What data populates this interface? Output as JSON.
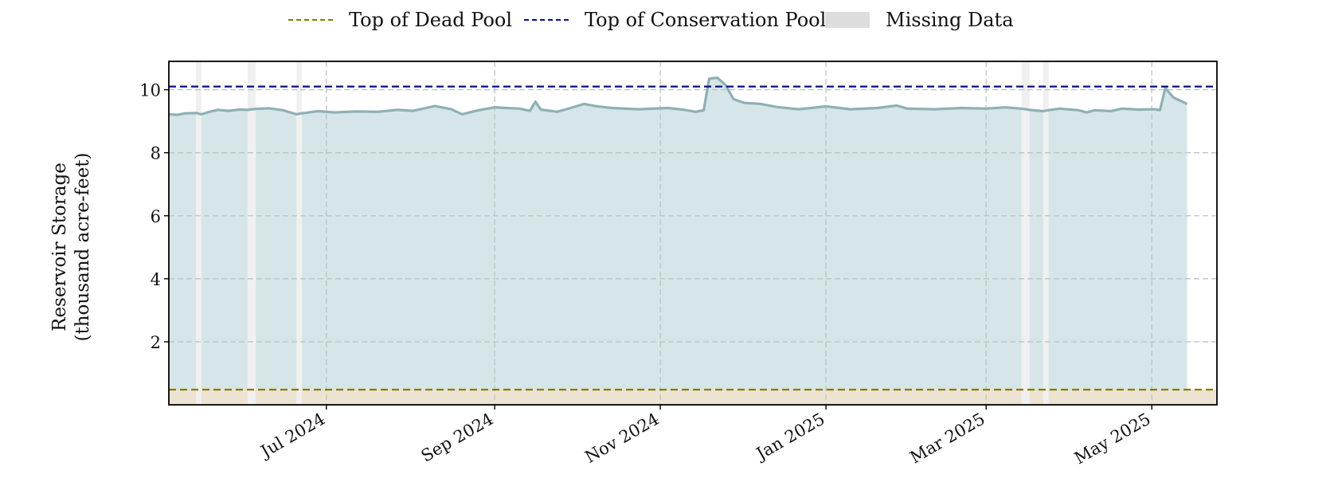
{
  "legend": {
    "dead_pool": "Top of Dead Pool",
    "conservation_pool": "Top of Conservation Pool",
    "missing": "Missing Data"
  },
  "colors": {
    "storage_line": "#8fb0b4",
    "storage_fill": "#d6e6e8",
    "dead_pool_line": "#8a7a00",
    "dead_pool_fill": "#ece3d2",
    "conservation_line": "#0a0a8a",
    "missing_band": "#f0f0f0",
    "legend_missing_swatch": "#dddddd",
    "grid": "#b8c8c0"
  },
  "chart_data": {
    "type": "area",
    "ylabel_line1": "Reservoir Storage",
    "ylabel_line2": "(thousand acre-feet)",
    "xlim": [
      "2024-05-04",
      "2025-05-25"
    ],
    "ylim": [
      0,
      10.9
    ],
    "yticks": [
      2,
      4,
      6,
      8,
      10
    ],
    "xticks": [
      {
        "date": "2024-07-01",
        "label": "Jul 2024"
      },
      {
        "date": "2024-09-01",
        "label": "Sep 2024"
      },
      {
        "date": "2024-11-01",
        "label": "Nov 2024"
      },
      {
        "date": "2025-01-01",
        "label": "Jan 2025"
      },
      {
        "date": "2025-03-01",
        "label": "Mar 2025"
      },
      {
        "date": "2025-05-01",
        "label": "May 2025"
      }
    ],
    "grid": true,
    "legend_position": "top-center",
    "dead_pool_level": 0.48,
    "conservation_pool_level": 10.1,
    "missing_ranges": [
      [
        "2024-05-14",
        "2024-05-16"
      ],
      [
        "2024-06-02",
        "2024-06-05"
      ],
      [
        "2024-06-20",
        "2024-06-22"
      ],
      [
        "2025-03-14",
        "2025-03-17"
      ],
      [
        "2025-03-22",
        "2025-03-24"
      ]
    ],
    "series": [
      {
        "name": "Reservoir Storage",
        "points": [
          [
            "2024-05-04",
            9.22
          ],
          [
            "2024-05-07",
            9.2
          ],
          [
            "2024-05-10",
            9.25
          ],
          [
            "2024-05-14",
            9.26
          ],
          [
            "2024-05-16",
            9.22
          ],
          [
            "2024-05-19",
            9.3
          ],
          [
            "2024-05-22",
            9.36
          ],
          [
            "2024-05-26",
            9.33
          ],
          [
            "2024-05-30",
            9.37
          ],
          [
            "2024-06-02",
            9.36
          ],
          [
            "2024-06-05",
            9.39
          ],
          [
            "2024-06-10",
            9.41
          ],
          [
            "2024-06-15",
            9.35
          ],
          [
            "2024-06-20",
            9.22
          ],
          [
            "2024-06-22",
            9.25
          ],
          [
            "2024-06-28",
            9.32
          ],
          [
            "2024-07-04",
            9.28
          ],
          [
            "2024-07-12",
            9.31
          ],
          [
            "2024-07-20",
            9.3
          ],
          [
            "2024-07-27",
            9.36
          ],
          [
            "2024-08-02",
            9.33
          ],
          [
            "2024-08-10",
            9.48
          ],
          [
            "2024-08-16",
            9.38
          ],
          [
            "2024-08-20",
            9.22
          ],
          [
            "2024-08-26",
            9.35
          ],
          [
            "2024-09-01",
            9.44
          ],
          [
            "2024-09-10",
            9.4
          ],
          [
            "2024-09-14",
            9.33
          ],
          [
            "2024-09-16",
            9.62
          ],
          [
            "2024-09-18",
            9.37
          ],
          [
            "2024-09-24",
            9.3
          ],
          [
            "2024-09-29",
            9.42
          ],
          [
            "2024-10-04",
            9.55
          ],
          [
            "2024-10-08",
            9.48
          ],
          [
            "2024-10-14",
            9.42
          ],
          [
            "2024-10-24",
            9.38
          ],
          [
            "2024-11-04",
            9.42
          ],
          [
            "2024-11-10",
            9.36
          ],
          [
            "2024-11-14",
            9.3
          ],
          [
            "2024-11-17",
            9.35
          ],
          [
            "2024-11-19",
            10.35
          ],
          [
            "2024-11-22",
            10.38
          ],
          [
            "2024-11-25",
            10.15
          ],
          [
            "2024-11-28",
            9.7
          ],
          [
            "2024-12-02",
            9.58
          ],
          [
            "2024-12-08",
            9.55
          ],
          [
            "2024-12-14",
            9.45
          ],
          [
            "2024-12-22",
            9.38
          ],
          [
            "2025-01-01",
            9.47
          ],
          [
            "2025-01-10",
            9.38
          ],
          [
            "2025-01-20",
            9.42
          ],
          [
            "2025-01-27",
            9.5
          ],
          [
            "2025-01-31",
            9.4
          ],
          [
            "2025-02-10",
            9.38
          ],
          [
            "2025-02-20",
            9.42
          ],
          [
            "2025-03-01",
            9.4
          ],
          [
            "2025-03-08",
            9.44
          ],
          [
            "2025-03-14",
            9.4
          ],
          [
            "2025-03-17",
            9.36
          ],
          [
            "2025-03-21",
            9.33
          ],
          [
            "2025-03-22",
            9.32
          ],
          [
            "2025-03-24",
            9.35
          ],
          [
            "2025-03-28",
            9.4
          ],
          [
            "2025-04-04",
            9.35
          ],
          [
            "2025-04-07",
            9.28
          ],
          [
            "2025-04-10",
            9.35
          ],
          [
            "2025-04-16",
            9.32
          ],
          [
            "2025-04-20",
            9.4
          ],
          [
            "2025-04-26",
            9.37
          ],
          [
            "2025-05-02",
            9.38
          ],
          [
            "2025-05-04",
            9.35
          ],
          [
            "2025-05-06",
            10.05
          ],
          [
            "2025-05-09",
            9.75
          ],
          [
            "2025-05-14",
            9.55
          ]
        ]
      }
    ]
  }
}
